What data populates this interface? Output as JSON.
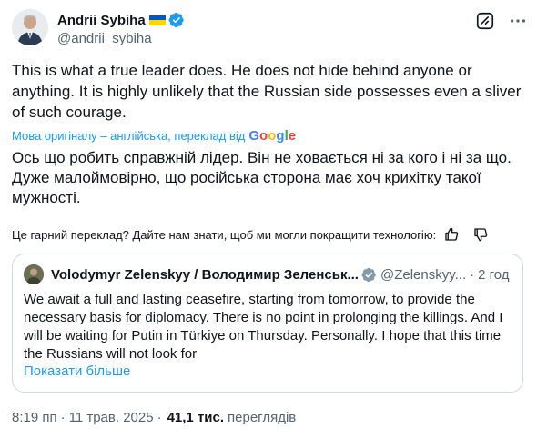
{
  "author": {
    "name": "Andrii Sybiha",
    "handle": "@andrii_sybiha"
  },
  "icons": {
    "flag": "ukraine-flag-icon",
    "verified": "verified-badge-icon",
    "grok": "grok-icon",
    "more": "more-options-icon",
    "thumbs_up": "thumbs-up-icon",
    "thumbs_down": "thumbs-down-icon"
  },
  "colors": {
    "accent": "#1d9bf0",
    "text": "#0f1419",
    "secondary": "#536471",
    "border": "#cfd9de"
  },
  "tweet": {
    "text": "This is what a true leader does. He does not hide behind anyone or anything. It is highly unlikely that the Russian side possesses even a sliver of such courage.",
    "translated_by_label": "Мова оригіналу – англійська, переклад від",
    "google": {
      "g1": "G",
      "o1": "o",
      "o2": "o",
      "g2": "g",
      "l": "l",
      "e": "e"
    },
    "translation": "Ось що робить справжній лідер. Він не ховається ні за кого і ні за що. Дуже малоймовірно, що російська сторона має хоч крихітку такої мужності.",
    "feedback_question": "Це гарний переклад? Дайте нам знати, щоб ми могли покращити технологію:"
  },
  "quote": {
    "name": "Volodymyr Zelenskyy / Володимир Зеленськ...",
    "handle": "@Zelenskyy...",
    "dot": "·",
    "time": "2 год",
    "text": "We await a full and lasting ceasefire, starting from tomorrow, to provide the necessary basis for diplomacy. There is no point in prolonging the killings. And I will be waiting for Putin in Türkiye on Thursday. Personally. I hope that this time the Russians will not look for",
    "show_more": "Показати більше"
  },
  "meta": {
    "time": "8:19 пп",
    "dot": "·",
    "date": "11 трав. 2025",
    "dot2": "·",
    "views_count": "41,1 тис.",
    "views_label": "переглядів"
  }
}
